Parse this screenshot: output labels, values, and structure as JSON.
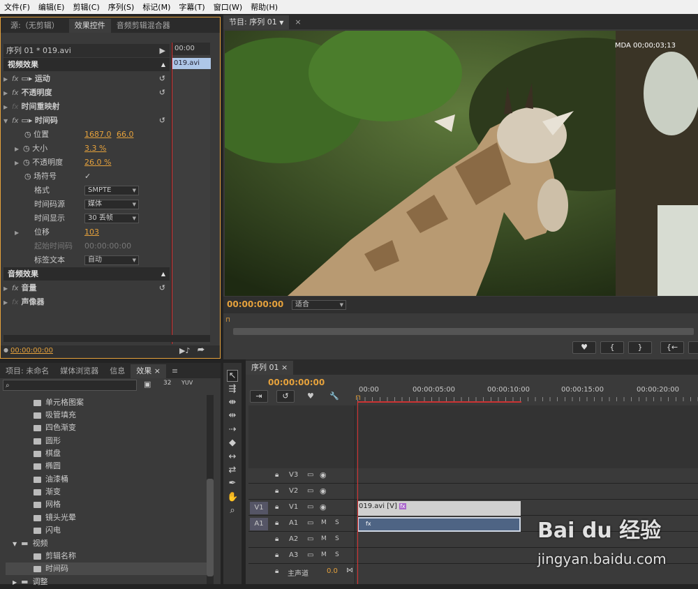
{
  "menu": [
    "文件(F)",
    "编辑(E)",
    "剪辑(C)",
    "序列(S)",
    "标记(M)",
    "字幕(T)",
    "窗口(W)",
    "帮助(H)"
  ],
  "effect_controls": {
    "tabs": [
      "源:（无剪辑）",
      "效果控件",
      "音频剪辑混合器"
    ],
    "clip_label": "序列 01 * 019.avi",
    "ruler_time": "00:00",
    "clip_bar": "019.avi",
    "video_effects_header": "视频效果",
    "motion": "运动",
    "opacity": "不透明度",
    "time_remap": "时间重映射",
    "timecode": "时间码",
    "position_label": "位置",
    "position_x": "1687.0",
    "position_y": "66.0",
    "size_label": "大小",
    "size_val": "3.3 %",
    "opacity_label": "不透明度",
    "opacity_val": "26.0 %",
    "field_label": "场符号",
    "format_label": "格式",
    "format_val": "SMPTE",
    "source_label": "时间码源",
    "source_val": "媒体",
    "display_label": "时间显示",
    "display_val": "30 丢帧",
    "offset_label": "位移",
    "offset_val": "103",
    "start_label": "起始时间码",
    "start_val": "00:00:00:00",
    "label_text_label": "标签文本",
    "label_text_val": "自动",
    "audio_effects_header": "音频效果",
    "volume": "音量",
    "panner": "声像器",
    "bottom_time": "00:00:00:00"
  },
  "program": {
    "tab": "节目: 序列 01",
    "overlay": "MDA 00;00;03;13",
    "timecode": "00:00:00:00",
    "fit": "适合"
  },
  "project": {
    "tabs": [
      "项目: 未命名",
      "媒体浏览器",
      "信息",
      "效果"
    ],
    "items": [
      "单元格图案",
      "吸管填充",
      "四色渐变",
      "圆形",
      "棋盘",
      "椭圆",
      "油漆桶",
      "渐变",
      "网格",
      "镜头光晕",
      "闪电"
    ],
    "folder_video": "视频",
    "video_items": [
      "剪辑名称",
      "时间码"
    ],
    "folder_adjust": "调整"
  },
  "timeline": {
    "tab": "序列 01",
    "timecode": "00:00:00:00",
    "ruler": [
      "00:00",
      "00:00:05:00",
      "00:00:10:00",
      "00:00:15:00",
      "00:00:20:00"
    ],
    "tracks": [
      "V3",
      "V2",
      "V1",
      "A1",
      "A2",
      "A3"
    ],
    "src_v1": "V1",
    "src_a1": "A1",
    "master": "主声道",
    "master_val": "0.0",
    "clip": "019.avi [V]",
    "clip_fx": "fx"
  },
  "watermark": {
    "brand": "Bai du 经验",
    "url": "jingyan.baidu.com"
  }
}
